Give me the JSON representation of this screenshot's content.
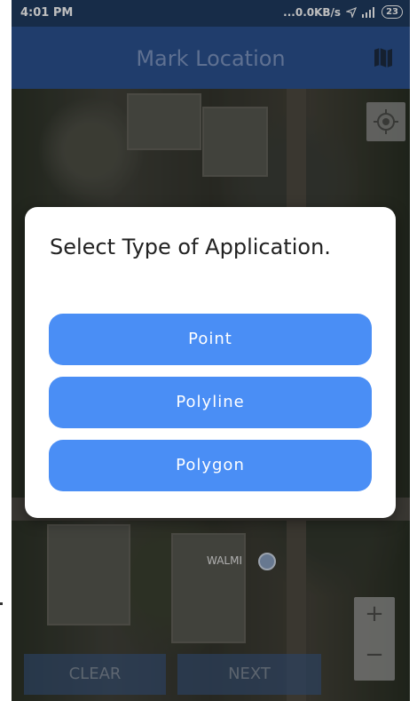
{
  "status_bar": {
    "time": "4:01 PM",
    "network_speed": "...0.0KB/s",
    "battery": "23"
  },
  "app_bar": {
    "title": "Mark Location",
    "map_icon": "map-icon"
  },
  "map": {
    "place_label": "WALMI",
    "zoom_in": "+",
    "zoom_out": "−"
  },
  "dialog": {
    "title": "Select Type of Application.",
    "options": [
      "Point",
      "Polyline",
      "Polygon"
    ]
  },
  "bottom_bar": {
    "clear_label": "CLEAR",
    "next_label": "NEXT"
  },
  "colors": {
    "accent": "#4a8ef5",
    "app_bar": "#2b5290",
    "status_bar": "#1f3b60"
  }
}
